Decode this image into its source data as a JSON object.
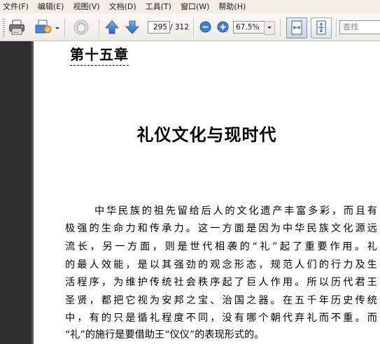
{
  "menu": [
    "文件(F)",
    "编辑(E)",
    "视图(V)",
    "文档(D)",
    "工具(T)",
    "窗口(W)",
    "帮助(H)"
  ],
  "toolbar": {
    "print_icon": "printer-icon",
    "organizer_icon": "organizer-icon",
    "hand_icon": "hand-tool-icon",
    "prev_icon": "up-arrow-icon",
    "next_icon": "down-arrow-icon",
    "page_current": "295",
    "page_total": "/ 312",
    "zoom_out_icon": "zoom-out-icon",
    "zoom_in_icon": "zoom-in-icon",
    "zoom_value": "67.5%",
    "fit_width_icon": "fit-width-icon",
    "fit_page_icon": "fit-page-icon",
    "search_placeholder": "查找",
    "colors": {
      "nav_blue": "#3a74c4",
      "zoom_blue": "#2d6fc2",
      "left_pane": "#2f2f2f"
    }
  },
  "document": {
    "chapter": "第十五章",
    "title": "礼仪文化与现时代",
    "lines": [
      "中华民族的祖先留给后人的文化遗产丰富多彩，而且有",
      "极强的生命力和传承力。这一方面是因为中华民族文化源远",
      "流长，另一方面，则是世代相袭的“礼”起了重要作用。礼",
      "的最人效能，是以其强劲的观念形态，规范人们的行力及生",
      "活程序，为维护传统社会秩序起了巨人作用。所以历代君王",
      "圣贤，都把它视为安邦之宝、治国之器。在五千年历史传统",
      "中，有的只是循礼程度不同，没有哪个朝代弃礼而不重。而",
      "“礼”的施行是要借助王“仪仪”的表现形式的。"
    ]
  }
}
